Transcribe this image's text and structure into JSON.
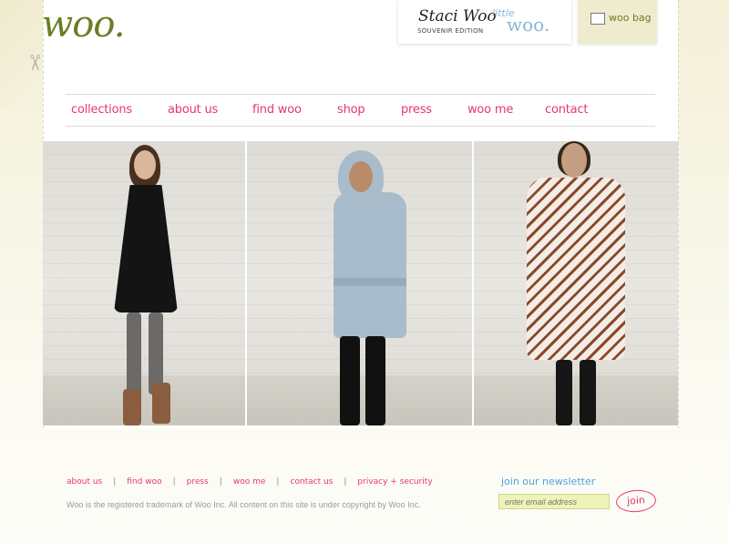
{
  "logo": "woo.",
  "brands": {
    "staci_woo": "Staci Woo",
    "souvenir_edition": "SOUVENIR EDITION",
    "little": "little",
    "little_woo": "woo.",
    "woo_bag": "woo bag"
  },
  "nav": [
    "collections",
    "about us",
    "find woo",
    "shop",
    "press",
    "woo me",
    "contact"
  ],
  "photos": [
    {
      "name": "model-black-tunic"
    },
    {
      "name": "model-hooded-coat"
    },
    {
      "name": "model-print-dress"
    }
  ],
  "footer": {
    "links": [
      "about us",
      "find woo",
      "press",
      "woo me",
      "contact us",
      "privacy + security"
    ],
    "separator": "|",
    "copyright": "Woo is the registered trademark of Woo Inc. All content on this site is under copyright by Woo Inc."
  },
  "newsletter": {
    "label": "join our newsletter",
    "placeholder": "enter email address",
    "button": "join"
  },
  "colors": {
    "accent_pink": "#e8337a",
    "logo_green": "#6a7d25",
    "newsletter_blue": "#4aa3df",
    "input_bg": "#eef3b8"
  }
}
